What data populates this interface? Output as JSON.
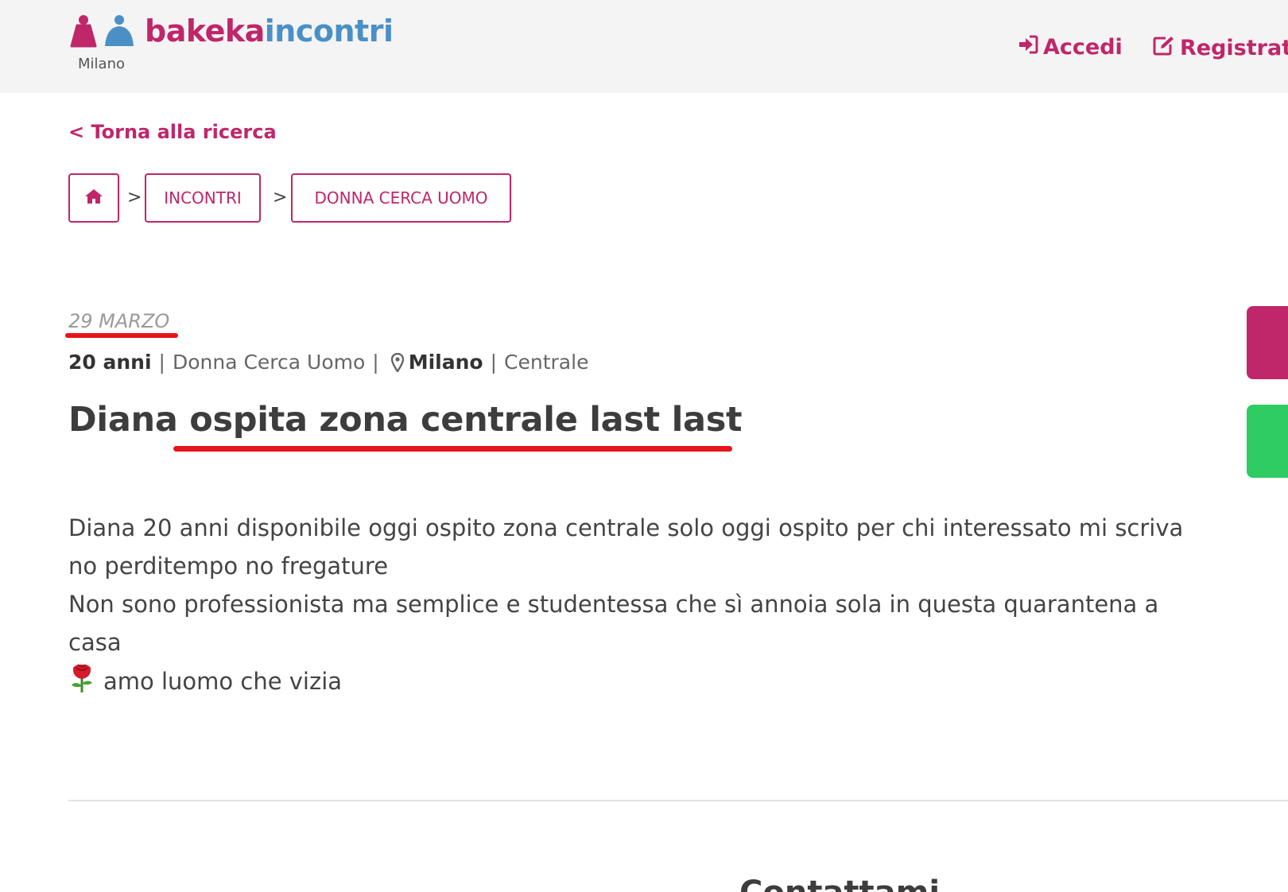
{
  "header": {
    "logo": {
      "part1": "bakeka",
      "part2": "incontri"
    },
    "city": "Milano",
    "login_label": "Accedi",
    "register_label": "Registrati"
  },
  "back_link": "< Torna alla ricerca",
  "breadcrumb": {
    "items": [
      {
        "label": "INCONTRI"
      },
      {
        "label": "DONNA CERCA UOMO"
      }
    ],
    "separator": ">"
  },
  "ad": {
    "date": "29 MARZO",
    "age": "20 anni",
    "category": "Donna Cerca Uomo",
    "city": "Milano",
    "zone": "Centrale",
    "title": "Diana ospita zona centrale last last",
    "description": {
      "line1": "Diana 20 anni disponibile oggi ospito zona centrale solo oggi ospito per chi interessato mi scriva no perditempo no fregature",
      "line2": "Non sono professionista ma semplice e studentessa che sì annoia sola in questa quarantena a casa",
      "line3": "amo luomo che vizia"
    }
  },
  "contact_heading": "Contattami",
  "colors": {
    "brand_pink": "#c0266a",
    "brand_blue": "#4a90c6",
    "annotation_red": "#e8141b",
    "side_green": "#2ecc62"
  },
  "icons": [
    "logo-figures-icon",
    "sign-in-icon",
    "edit-icon",
    "home-icon",
    "map-pin-icon",
    "rose-emoji-icon"
  ]
}
